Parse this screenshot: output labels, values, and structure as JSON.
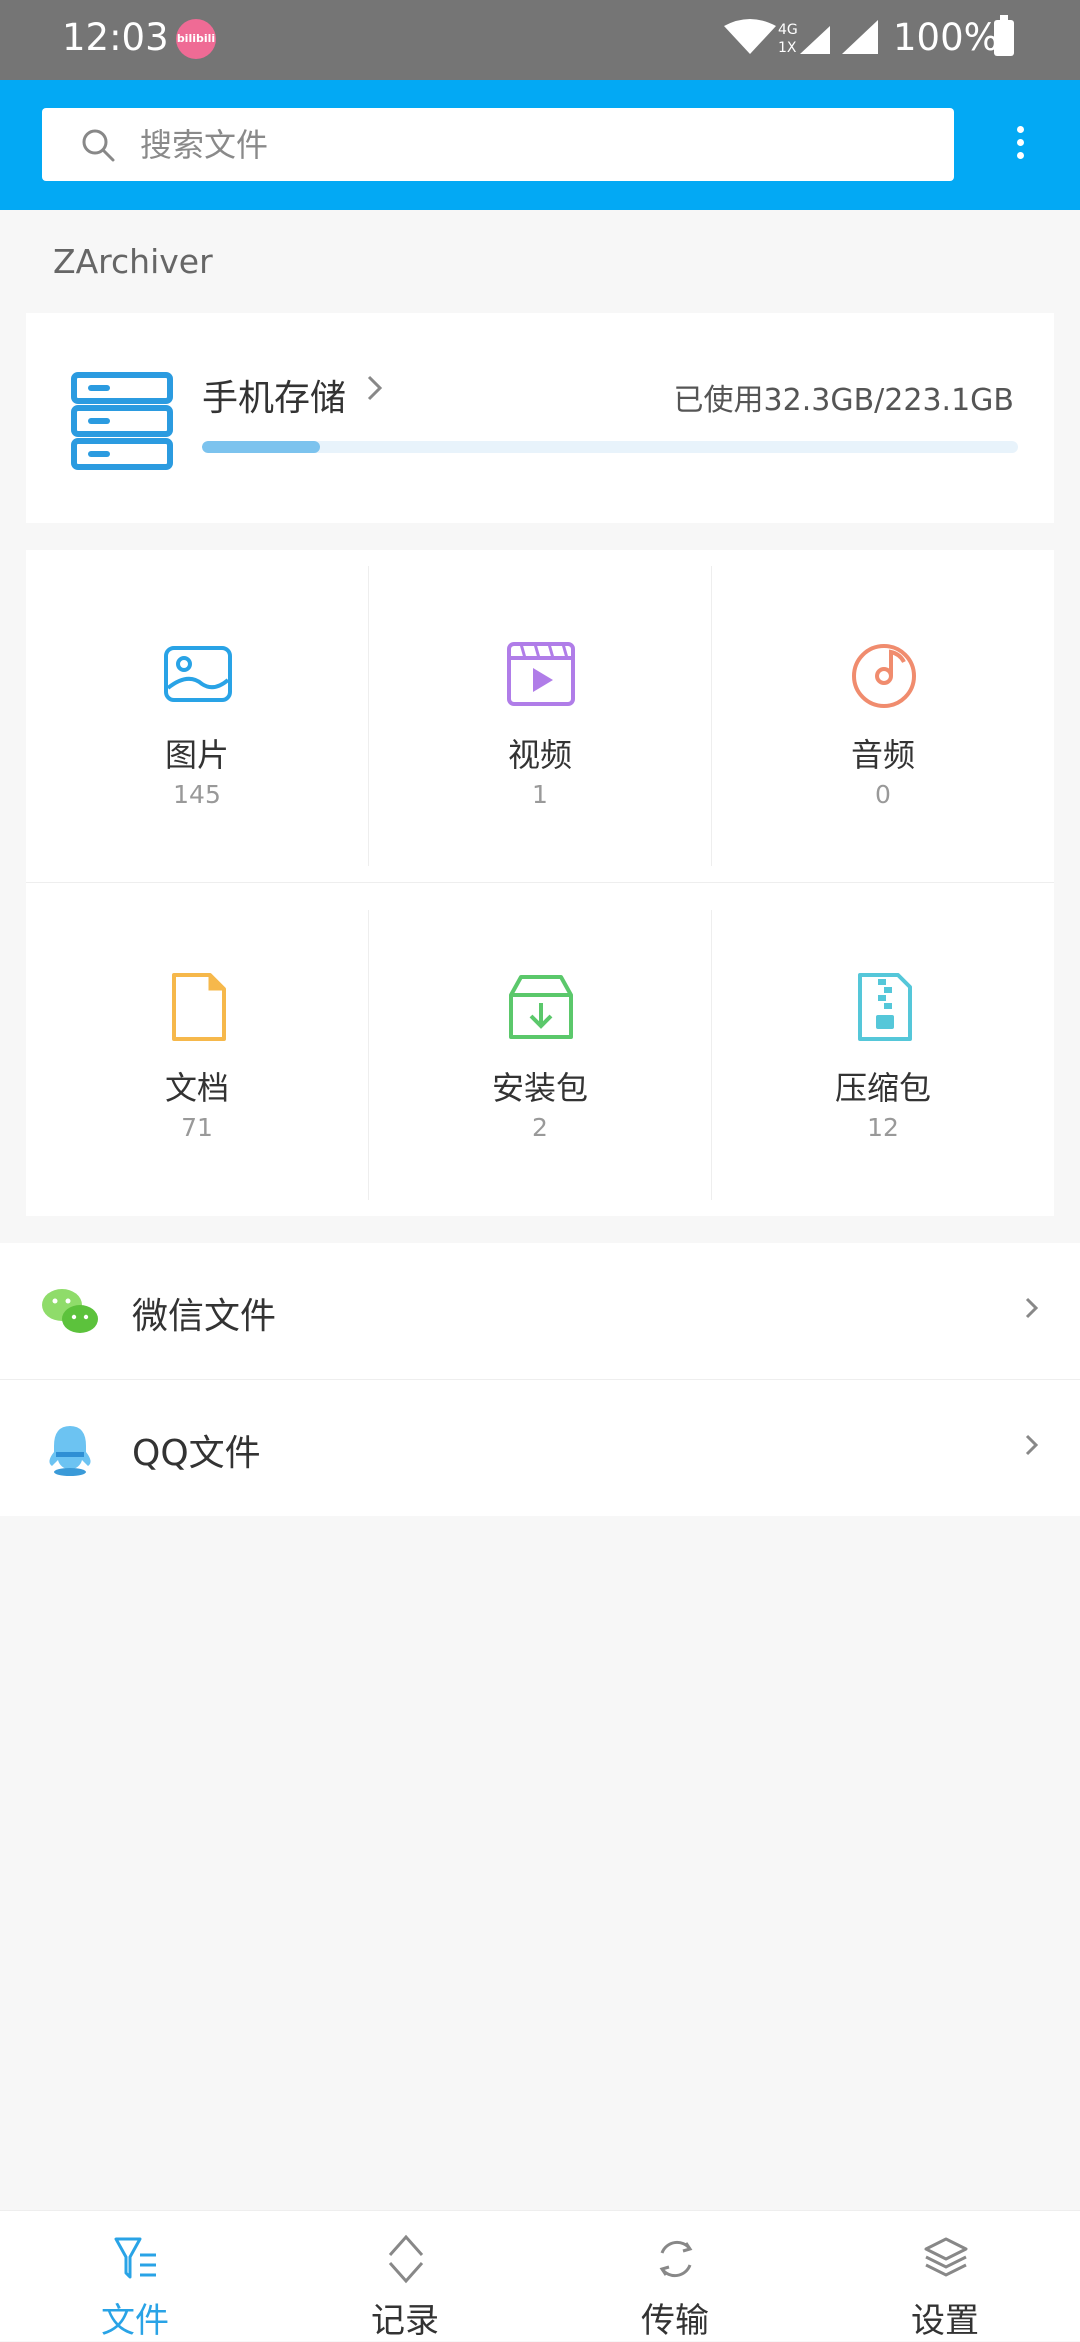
{
  "status_bar": {
    "time": "12:03",
    "app_badge": "bilibili",
    "network": "4G",
    "network_sub": "1X",
    "battery": "100%"
  },
  "search": {
    "placeholder": "搜索文件"
  },
  "section_label": "ZArchiver",
  "storage": {
    "title": "手机存储",
    "used_text": "已使用32.3GB/223.1GB",
    "used_fraction": 0.1448
  },
  "categories": [
    {
      "label": "图片",
      "count": "145",
      "icon": "image-icon",
      "color": "#29a3e6"
    },
    {
      "label": "视频",
      "count": "1",
      "icon": "video-icon",
      "color": "#b07de8"
    },
    {
      "label": "音频",
      "count": "0",
      "icon": "audio-icon",
      "color": "#f08c6e"
    },
    {
      "label": "文档",
      "count": "71",
      "icon": "document-icon",
      "color": "#f6b84b"
    },
    {
      "label": "安装包",
      "count": "2",
      "icon": "package-icon",
      "color": "#5bc86b"
    },
    {
      "label": "压缩包",
      "count": "12",
      "icon": "archive-icon",
      "color": "#55c7d9"
    }
  ],
  "rows": [
    {
      "label": "微信文件",
      "icon": "wechat-icon"
    },
    {
      "label": "QQ文件",
      "icon": "qq-icon"
    }
  ],
  "bottom_nav": [
    {
      "label": "文件",
      "icon": "files-icon",
      "active": true
    },
    {
      "label": "记录",
      "icon": "history-icon",
      "active": false
    },
    {
      "label": "传输",
      "icon": "transfer-icon",
      "active": false
    },
    {
      "label": "设置",
      "icon": "settings-icon",
      "active": false
    }
  ],
  "colors": {
    "accent": "#03a9f4",
    "status_bar": "#757575",
    "nav_active": "#29a3e6",
    "nav_inactive": "#888888"
  }
}
